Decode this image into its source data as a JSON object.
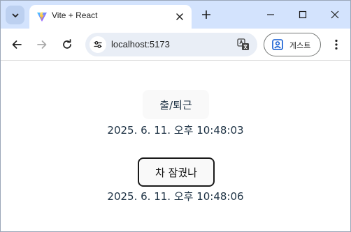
{
  "tab": {
    "title": "Vite + React"
  },
  "omnibox": {
    "url": "localhost:5173"
  },
  "profile": {
    "label": "게스트"
  },
  "page": {
    "work_button_label": "출/퇴근",
    "work_time": "2025. 6. 11. 오후 10:48:03",
    "car_button_label": "차 잠궜나",
    "car_time": "2025. 6. 11. 오후 10:48:06"
  },
  "icons": {
    "tab_search": "chevron-down-icon",
    "favicon": "vite-logo-icon",
    "tab_close": "close-icon",
    "new_tab": "plus-icon",
    "minimize": "minimize-icon",
    "maximize": "maximize-icon",
    "window_close": "close-icon",
    "back": "arrow-left-icon",
    "forward": "arrow-right-icon",
    "reload": "reload-icon",
    "site_info": "tune-icon",
    "translate": "translate-icon",
    "profile": "person-badge-icon",
    "menu": "kebab-menu-icon"
  },
  "colors": {
    "tabstrip_bg": "#d3e3fd",
    "omnibox_bg": "#e9eef6",
    "page_text": "#213547",
    "button_bg": "#f9f9f9",
    "focused_border": "#1a1a1a"
  }
}
